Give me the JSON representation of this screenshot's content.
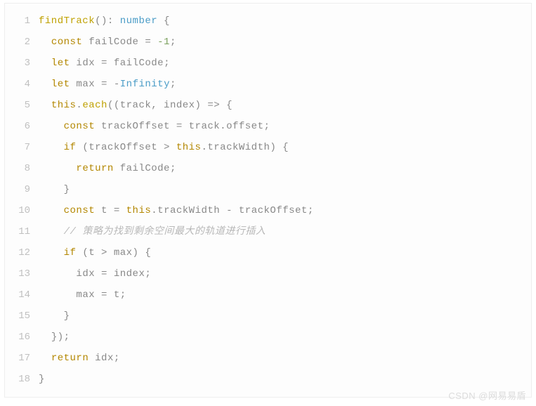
{
  "watermark": "CSDN @网易易盾",
  "code": {
    "lines": [
      {
        "num": "1",
        "tokens": [
          {
            "c": "fn",
            "t": "findTrack"
          },
          {
            "c": "op",
            "t": "(): "
          },
          {
            "c": "ty",
            "t": "number"
          },
          {
            "c": "op",
            "t": " {"
          }
        ]
      },
      {
        "num": "2",
        "indent": 2,
        "tokens": [
          {
            "c": "kw",
            "t": "const"
          },
          {
            "c": "id",
            "t": " failCode "
          },
          {
            "c": "op",
            "t": "= "
          },
          {
            "c": "num",
            "t": "-1"
          },
          {
            "c": "op",
            "t": ";"
          }
        ]
      },
      {
        "num": "3",
        "indent": 2,
        "tokens": [
          {
            "c": "kw",
            "t": "let"
          },
          {
            "c": "id",
            "t": " idx "
          },
          {
            "c": "op",
            "t": "= "
          },
          {
            "c": "id",
            "t": "failCode"
          },
          {
            "c": "op",
            "t": ";"
          }
        ]
      },
      {
        "num": "4",
        "indent": 2,
        "tokens": [
          {
            "c": "kw",
            "t": "let"
          },
          {
            "c": "id",
            "t": " max "
          },
          {
            "c": "op",
            "t": "= -"
          },
          {
            "c": "ty",
            "t": "Infinity"
          },
          {
            "c": "op",
            "t": ";"
          }
        ]
      },
      {
        "num": "5",
        "indent": 2,
        "tokens": [
          {
            "c": "kw",
            "t": "this"
          },
          {
            "c": "op",
            "t": "."
          },
          {
            "c": "fn",
            "t": "each"
          },
          {
            "c": "op",
            "t": "((track, index) "
          },
          {
            "c": "op",
            "t": "=>"
          },
          {
            "c": "op",
            "t": " {"
          }
        ]
      },
      {
        "num": "6",
        "indent": 4,
        "tokens": [
          {
            "c": "kw",
            "t": "const"
          },
          {
            "c": "id",
            "t": " trackOffset "
          },
          {
            "c": "op",
            "t": "= "
          },
          {
            "c": "id",
            "t": "track"
          },
          {
            "c": "op",
            "t": "."
          },
          {
            "c": "id",
            "t": "offset"
          },
          {
            "c": "op",
            "t": ";"
          }
        ]
      },
      {
        "num": "7",
        "indent": 4,
        "tokens": [
          {
            "c": "kw",
            "t": "if"
          },
          {
            "c": "op",
            "t": " (trackOffset > "
          },
          {
            "c": "kw",
            "t": "this"
          },
          {
            "c": "op",
            "t": "."
          },
          {
            "c": "id",
            "t": "trackWidth"
          },
          {
            "c": "op",
            "t": ") {"
          }
        ]
      },
      {
        "num": "8",
        "indent": 6,
        "tokens": [
          {
            "c": "kw",
            "t": "return"
          },
          {
            "c": "id",
            "t": " failCode"
          },
          {
            "c": "op",
            "t": ";"
          }
        ]
      },
      {
        "num": "9",
        "indent": 4,
        "tokens": [
          {
            "c": "op",
            "t": "}"
          }
        ]
      },
      {
        "num": "10",
        "indent": 4,
        "tokens": [
          {
            "c": "kw",
            "t": "const"
          },
          {
            "c": "id",
            "t": " t "
          },
          {
            "c": "op",
            "t": "= "
          },
          {
            "c": "kw",
            "t": "this"
          },
          {
            "c": "op",
            "t": "."
          },
          {
            "c": "id",
            "t": "trackWidth"
          },
          {
            "c": "op",
            "t": " - "
          },
          {
            "c": "id",
            "t": "trackOffset"
          },
          {
            "c": "op",
            "t": ";"
          }
        ]
      },
      {
        "num": "11",
        "indent": 4,
        "tokens": [
          {
            "c": "cm",
            "t": "// 策略为找到剩余空间最大的轨道进行插入"
          }
        ]
      },
      {
        "num": "12",
        "indent": 4,
        "tokens": [
          {
            "c": "kw",
            "t": "if"
          },
          {
            "c": "op",
            "t": " (t > max) {"
          }
        ]
      },
      {
        "num": "13",
        "indent": 6,
        "tokens": [
          {
            "c": "id",
            "t": "idx "
          },
          {
            "c": "op",
            "t": "= "
          },
          {
            "c": "id",
            "t": "index"
          },
          {
            "c": "op",
            "t": ";"
          }
        ]
      },
      {
        "num": "14",
        "indent": 6,
        "tokens": [
          {
            "c": "id",
            "t": "max "
          },
          {
            "c": "op",
            "t": "= "
          },
          {
            "c": "id",
            "t": "t"
          },
          {
            "c": "op",
            "t": ";"
          }
        ]
      },
      {
        "num": "15",
        "indent": 4,
        "tokens": [
          {
            "c": "op",
            "t": "}"
          }
        ]
      },
      {
        "num": "16",
        "indent": 2,
        "tokens": [
          {
            "c": "op",
            "t": "});"
          }
        ]
      },
      {
        "num": "17",
        "indent": 2,
        "tokens": [
          {
            "c": "kw",
            "t": "return"
          },
          {
            "c": "id",
            "t": " idx"
          },
          {
            "c": "op",
            "t": ";"
          }
        ]
      },
      {
        "num": "18",
        "indent": 0,
        "tokens": [
          {
            "c": "op",
            "t": "}"
          }
        ]
      }
    ]
  }
}
